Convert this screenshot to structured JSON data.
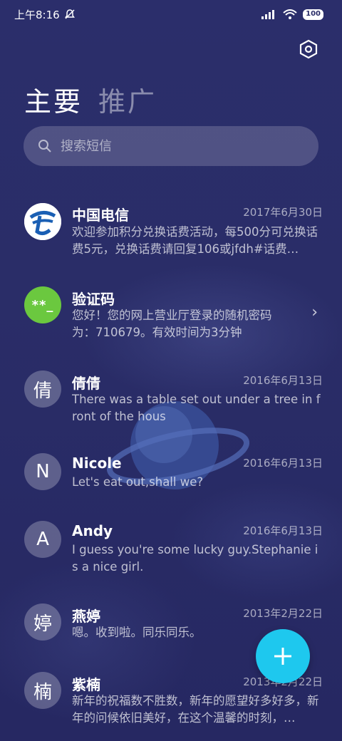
{
  "status_bar": {
    "time": "上午8:16",
    "battery": "100",
    "mute_icon": "bell-off-icon",
    "signal_icon": "signal-icon",
    "wifi_icon": "wifi-icon"
  },
  "header": {
    "settings_icon": "hexagon-settings-icon",
    "tabs": [
      {
        "label": "主要",
        "active": true
      },
      {
        "label": "推广",
        "active": false
      }
    ]
  },
  "search": {
    "placeholder": "搜索短信",
    "value": ""
  },
  "conversations": [
    {
      "avatar": "",
      "avatar_type": "telecom-logo",
      "name": "中国电信",
      "date": "2017年6月30日",
      "snippet": "欢迎参加积分兑换话费活动，每500分可兑换话费5元，兑换话费请回复106或jfdh#话费…"
    },
    {
      "avatar": "**_",
      "avatar_type": "verification-code",
      "name": "验证码",
      "date": "",
      "snippet": "您好！您的网上营业厅登录的随机密码为：710679。有效时间为3分钟",
      "chevron": "›"
    },
    {
      "avatar": "倩",
      "avatar_type": "letter",
      "name": "倩倩",
      "date": "2016年6月13日",
      "snippet": "There was a table set out under a tree in front of the hous"
    },
    {
      "avatar": "N",
      "avatar_type": "letter",
      "name": "Nicole",
      "date": "2016年6月13日",
      "snippet": "Let's eat out,shall we?"
    },
    {
      "avatar": "A",
      "avatar_type": "letter",
      "name": "Andy",
      "date": "2016年6月13日",
      "snippet": "I guess you're some lucky guy.Stephanie is a nice girl."
    },
    {
      "avatar": "婷",
      "avatar_type": "letter",
      "name": "燕婷",
      "date": "2013年2月22日",
      "snippet": "嗯。收到啦。同乐同乐。"
    },
    {
      "avatar": "楠",
      "avatar_type": "letter",
      "name": "紫楠",
      "date": "2013年2月22日",
      "snippet": "新年的祝福数不胜数，新年的愿望好多好多，新年的问候依旧美好，在这个温馨的时刻，…"
    }
  ],
  "fab": {
    "icon": "plus-icon",
    "color": "#1ec8ee"
  },
  "colors": {
    "background": "#2a2d68",
    "accent": "#1ec8ee",
    "code_avatar": "#6bc83f"
  }
}
